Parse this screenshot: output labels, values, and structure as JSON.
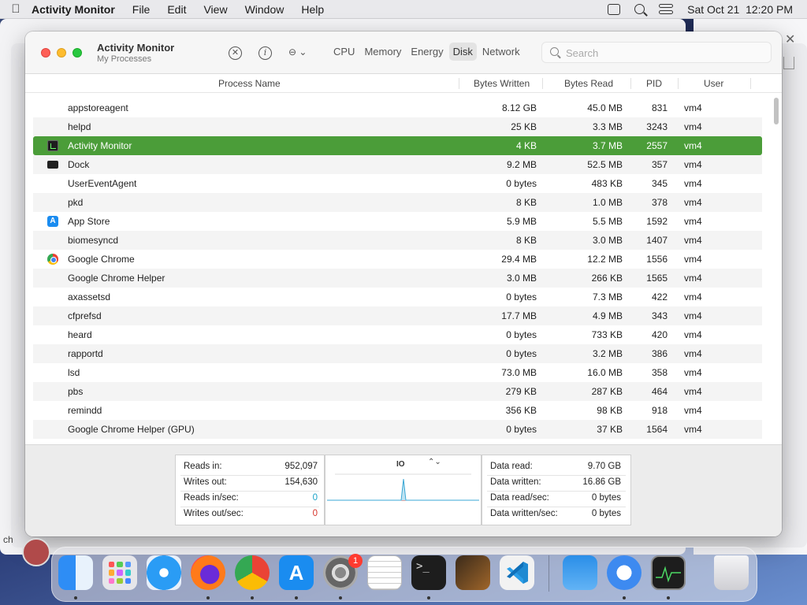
{
  "menubar": {
    "app": "Activity Monitor",
    "items": [
      "File",
      "Edit",
      "View",
      "Window",
      "Help"
    ],
    "datetime": "Sat Oct 21  12:20 PM"
  },
  "window": {
    "title": "Activity Monitor",
    "subtitle": "My Processes",
    "tabs": [
      "CPU",
      "Memory",
      "Energy",
      "Disk",
      "Network"
    ],
    "active_tab": "Disk",
    "search_placeholder": "Search"
  },
  "columns": {
    "name": "Process Name",
    "bytes_written": "Bytes Written",
    "bytes_read": "Bytes Read",
    "pid": "PID",
    "user": "User"
  },
  "processes": [
    {
      "name": "appstoreagent",
      "written": "8.12 GB",
      "read": "45.0 MB",
      "pid": "831",
      "user": "vm4",
      "icon": ""
    },
    {
      "name": "helpd",
      "written": "25 KB",
      "read": "3.3 MB",
      "pid": "3243",
      "user": "vm4",
      "icon": ""
    },
    {
      "name": "Activity Monitor",
      "written": "4 KB",
      "read": "3.7 MB",
      "pid": "2557",
      "user": "vm4",
      "icon": "activity-monitor-icon"
    },
    {
      "name": "Dock",
      "written": "9.2 MB",
      "read": "52.5 MB",
      "pid": "357",
      "user": "vm4",
      "icon": "dock-icon"
    },
    {
      "name": "UserEventAgent",
      "written": "0 bytes",
      "read": "483 KB",
      "pid": "345",
      "user": "vm4",
      "icon": ""
    },
    {
      "name": "pkd",
      "written": "8 KB",
      "read": "1.0 MB",
      "pid": "378",
      "user": "vm4",
      "icon": ""
    },
    {
      "name": "App Store",
      "written": "5.9 MB",
      "read": "5.5 MB",
      "pid": "1592",
      "user": "vm4",
      "icon": "app-store-icon"
    },
    {
      "name": "biomesyncd",
      "written": "8 KB",
      "read": "3.0 MB",
      "pid": "1407",
      "user": "vm4",
      "icon": ""
    },
    {
      "name": "Google Chrome",
      "written": "29.4 MB",
      "read": "12.2 MB",
      "pid": "1556",
      "user": "vm4",
      "icon": "chrome-icon"
    },
    {
      "name": "Google Chrome Helper",
      "written": "3.0 MB",
      "read": "266 KB",
      "pid": "1565",
      "user": "vm4",
      "icon": ""
    },
    {
      "name": "axassetsd",
      "written": "0 bytes",
      "read": "7.3 MB",
      "pid": "422",
      "user": "vm4",
      "icon": ""
    },
    {
      "name": "cfprefsd",
      "written": "17.7 MB",
      "read": "4.9 MB",
      "pid": "343",
      "user": "vm4",
      "icon": ""
    },
    {
      "name": "heard",
      "written": "0 bytes",
      "read": "733 KB",
      "pid": "420",
      "user": "vm4",
      "icon": ""
    },
    {
      "name": "rapportd",
      "written": "0 bytes",
      "read": "3.2 MB",
      "pid": "386",
      "user": "vm4",
      "icon": ""
    },
    {
      "name": "lsd",
      "written": "73.0 MB",
      "read": "16.0 MB",
      "pid": "358",
      "user": "vm4",
      "icon": ""
    },
    {
      "name": "pbs",
      "written": "279 KB",
      "read": "287 KB",
      "pid": "464",
      "user": "vm4",
      "icon": ""
    },
    {
      "name": "remindd",
      "written": "356 KB",
      "read": "98 KB",
      "pid": "918",
      "user": "vm4",
      "icon": ""
    },
    {
      "name": "Google Chrome Helper (GPU)",
      "written": "0 bytes",
      "read": "37 KB",
      "pid": "1564",
      "user": "vm4",
      "icon": ""
    }
  ],
  "selected_process": "Activity Monitor",
  "stats_left": [
    {
      "label": "Reads in:",
      "value": "952,097"
    },
    {
      "label": "Writes out:",
      "value": "154,630"
    },
    {
      "label": "Reads in/sec:",
      "value": "0"
    },
    {
      "label": "Writes out/sec:",
      "value": "0"
    }
  ],
  "graph": {
    "label": "IO",
    "selector": "⌃⌄"
  },
  "stats_right": [
    {
      "label": "Data read:",
      "value": "9.70 GB"
    },
    {
      "label": "Data written:",
      "value": "16.86 GB"
    },
    {
      "label": "Data read/sec:",
      "value": "0 bytes"
    },
    {
      "label": "Data written/sec:",
      "value": "0 bytes"
    }
  ],
  "colors": {
    "selection": "#4b9d39",
    "reads_per_sec": "#1aa3c8",
    "writes_per_sec": "#d6332a"
  },
  "dock": {
    "badge_count": "1",
    "apps": [
      "finder-icon",
      "launchpad-icon",
      "safari-icon",
      "firefox-icon",
      "chrome-icon",
      "app-store-icon",
      "system-settings-icon",
      "textedit-icon",
      "terminal-icon",
      "garageband-icon",
      "vscode-icon",
      "weather-icon",
      "shortcuts-icon",
      "activity-monitor-icon",
      "trash-icon"
    ]
  },
  "side_text": "ch"
}
